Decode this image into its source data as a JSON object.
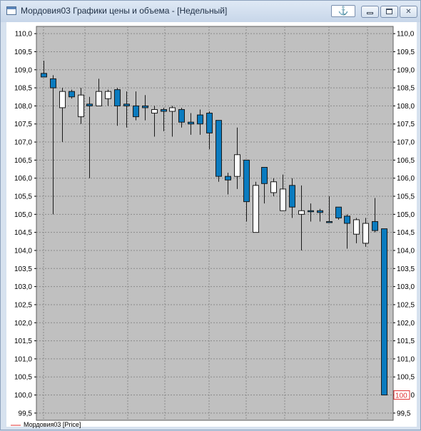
{
  "window": {
    "title": "Мордовия03 Графики цены и объема - [Недельный]",
    "anchor_glyph": "⚓"
  },
  "colors": {
    "plot_bg": "#c0c0c0",
    "grid": "#8a8a8a",
    "up": "#ffffff",
    "down": "#0a7bbf",
    "legend_line": "#e03030",
    "last_price": "#e03030"
  },
  "legend": {
    "label": "Мордовия03 [Price]"
  },
  "last_price_label": "100",
  "chart_data": {
    "type": "candlestick",
    "title": "",
    "xlabel": "",
    "ylabel": "",
    "ylim": [
      99.3,
      110.2
    ],
    "yticks": [
      "110,0",
      "109,5",
      "109,0",
      "108,5",
      "108,0",
      "107,5",
      "107,0",
      "106,5",
      "106,0",
      "105,5",
      "105,0",
      "104,5",
      "104,0",
      "103,5",
      "103,0",
      "102,5",
      "102,0",
      "101,5",
      "101,0",
      "100,5",
      "100,0",
      "99,5"
    ],
    "grid": true,
    "candles": [
      {
        "open": 108.9,
        "high": 109.25,
        "low": 108.8,
        "close": 108.8
      },
      {
        "open": 108.75,
        "high": 108.85,
        "low": 105.0,
        "close": 108.5
      },
      {
        "open": 107.95,
        "high": 108.5,
        "low": 107.0,
        "close": 108.4
      },
      {
        "open": 108.4,
        "high": 108.45,
        "low": 108.2,
        "close": 108.25
      },
      {
        "open": 107.7,
        "high": 108.5,
        "low": 107.5,
        "close": 108.3
      },
      {
        "open": 108.05,
        "high": 108.25,
        "low": 106.0,
        "close": 108.0
      },
      {
        "open": 108.0,
        "high": 108.75,
        "low": 108.0,
        "close": 108.4
      },
      {
        "open": 108.2,
        "high": 108.45,
        "low": 108.0,
        "close": 108.4
      },
      {
        "open": 108.45,
        "high": 108.5,
        "low": 107.45,
        "close": 108.0
      },
      {
        "open": 108.05,
        "high": 108.4,
        "low": 107.4,
        "close": 108.0
      },
      {
        "open": 108.0,
        "high": 108.4,
        "low": 107.6,
        "close": 107.7
      },
      {
        "open": 108.0,
        "high": 108.3,
        "low": 107.6,
        "close": 107.95
      },
      {
        "open": 107.8,
        "high": 108.0,
        "low": 107.15,
        "close": 107.9
      },
      {
        "open": 107.9,
        "high": 107.95,
        "low": 107.3,
        "close": 107.85
      },
      {
        "open": 107.85,
        "high": 108.0,
        "low": 107.15,
        "close": 107.95
      },
      {
        "open": 107.9,
        "high": 107.95,
        "low": 107.4,
        "close": 107.55
      },
      {
        "open": 107.55,
        "high": 107.8,
        "low": 107.2,
        "close": 107.5
      },
      {
        "open": 107.75,
        "high": 107.9,
        "low": 107.2,
        "close": 107.5
      },
      {
        "open": 107.8,
        "high": 107.85,
        "low": 106.8,
        "close": 107.25
      },
      {
        "open": 107.6,
        "high": 107.6,
        "low": 105.9,
        "close": 106.05
      },
      {
        "open": 106.05,
        "high": 106.15,
        "low": 105.55,
        "close": 105.95
      },
      {
        "open": 106.05,
        "high": 107.4,
        "low": 105.7,
        "close": 106.65
      },
      {
        "open": 106.5,
        "high": 106.5,
        "low": 104.8,
        "close": 105.35
      },
      {
        "open": 104.5,
        "high": 105.9,
        "low": 104.5,
        "close": 105.8
      },
      {
        "open": 106.3,
        "high": 106.3,
        "low": 105.3,
        "close": 105.85
      },
      {
        "open": 105.6,
        "high": 106.0,
        "low": 105.5,
        "close": 105.9
      },
      {
        "open": 105.1,
        "high": 106.1,
        "low": 105.1,
        "close": 105.7
      },
      {
        "open": 105.8,
        "high": 106.0,
        "low": 104.9,
        "close": 105.2
      },
      {
        "open": 105.0,
        "high": 105.8,
        "low": 104.0,
        "close": 105.1
      },
      {
        "open": 105.1,
        "high": 105.3,
        "low": 104.8,
        "close": 105.1
      },
      {
        "open": 105.1,
        "high": 105.15,
        "low": 104.8,
        "close": 105.05
      },
      {
        "open": 104.8,
        "high": 105.5,
        "low": 104.8,
        "close": 104.8
      },
      {
        "open": 105.2,
        "high": 105.2,
        "low": 104.85,
        "close": 104.9
      },
      {
        "open": 104.95,
        "high": 105.0,
        "low": 104.05,
        "close": 104.75
      },
      {
        "open": 104.45,
        "high": 104.9,
        "low": 104.2,
        "close": 104.85
      },
      {
        "open": 104.2,
        "high": 104.9,
        "low": 104.1,
        "close": 104.75
      },
      {
        "open": 104.8,
        "high": 105.45,
        "low": 104.5,
        "close": 104.55
      },
      {
        "open": 104.6,
        "high": 104.6,
        "low": 100.0,
        "close": 100.0
      }
    ]
  }
}
